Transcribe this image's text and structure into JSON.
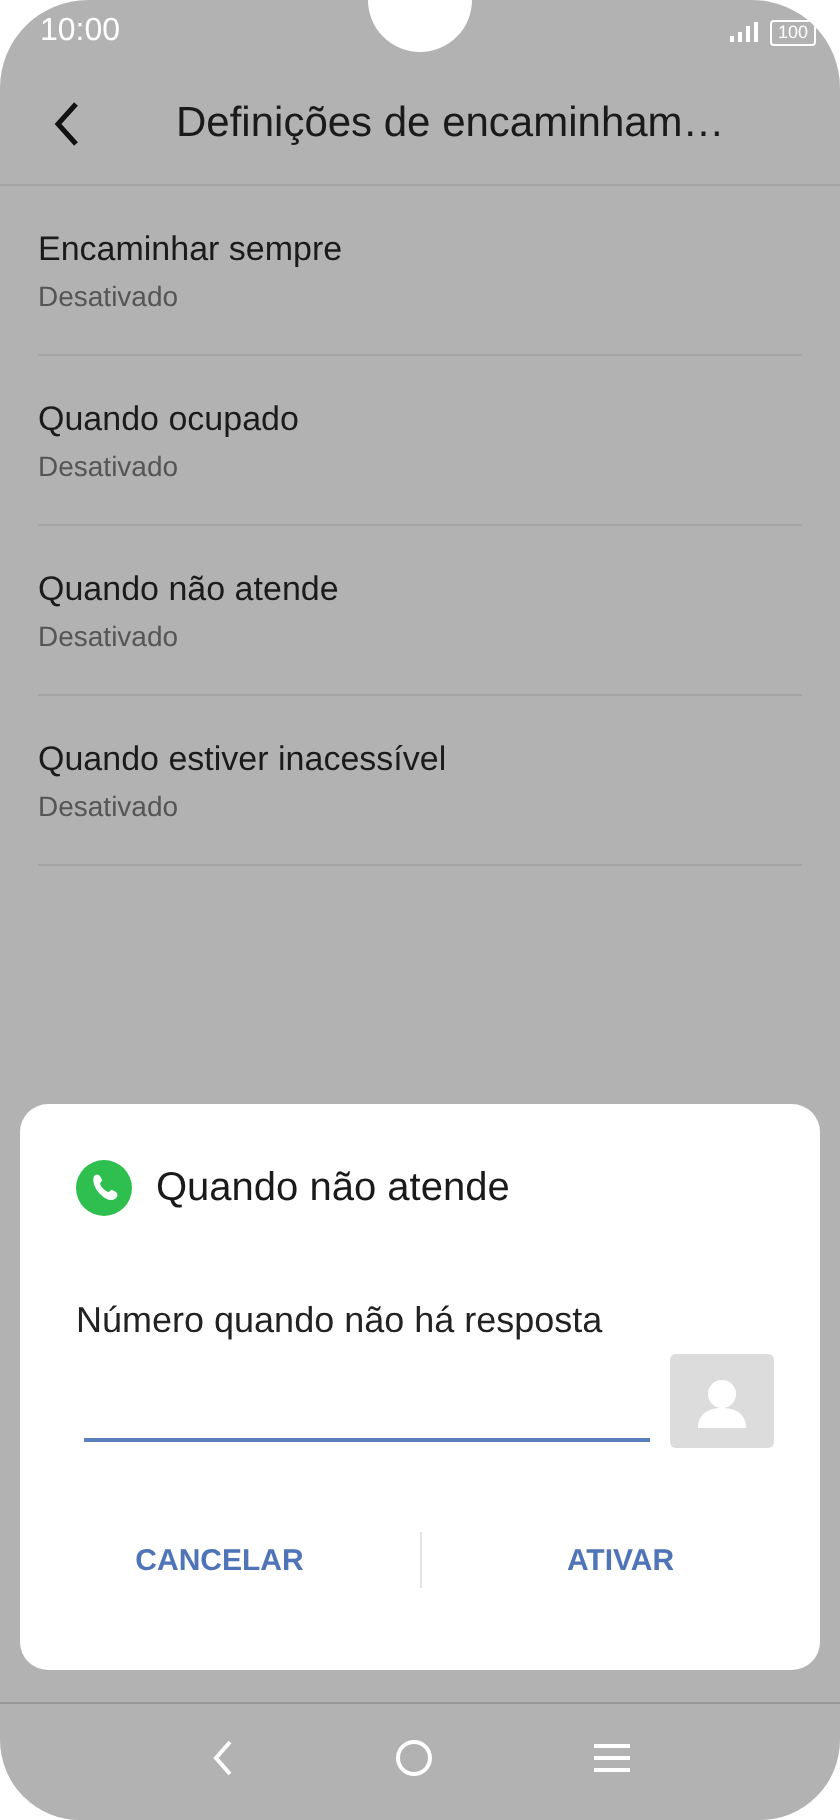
{
  "status_bar": {
    "time": "10:00",
    "battery": "100"
  },
  "header": {
    "title": "Definições de encaminham…"
  },
  "items": [
    {
      "title": "Encaminhar sempre",
      "subtitle": "Desativado"
    },
    {
      "title": "Quando ocupado",
      "subtitle": "Desativado"
    },
    {
      "title": "Quando não atende",
      "subtitle": "Desativado"
    },
    {
      "title": "Quando estiver inacessível",
      "subtitle": "Desativado"
    }
  ],
  "dialog": {
    "title": "Quando não atende",
    "label": "Número quando não há resposta",
    "buttons": [
      "CANCELAR",
      "ATIVAR"
    ]
  }
}
